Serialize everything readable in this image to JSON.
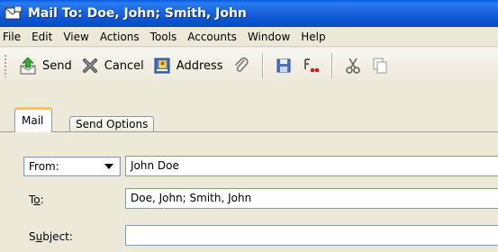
{
  "window": {
    "title": "Mail To: Doe, John; Smith, John"
  },
  "menu": [
    {
      "label": "File",
      "name": "menu-file"
    },
    {
      "label": "Edit",
      "name": "menu-edit"
    },
    {
      "label": "View",
      "name": "menu-view"
    },
    {
      "label": "Actions",
      "name": "menu-actions"
    },
    {
      "label": "Tools",
      "name": "menu-tools"
    },
    {
      "label": "Accounts",
      "name": "menu-accounts"
    },
    {
      "label": "Window",
      "name": "menu-window"
    },
    {
      "label": "Help",
      "name": "menu-help"
    }
  ],
  "toolbar": {
    "send_label": "Send",
    "cancel_label": "Cancel",
    "address_label": "Address",
    "icons": [
      "send-icon",
      "cancel-icon",
      "address-book-icon",
      "paperclip-icon",
      "save-icon",
      "spell-check-icon",
      "cut-icon",
      "copy-icon"
    ]
  },
  "tabs": {
    "mail": "Mail",
    "send_options": "Send Options"
  },
  "form": {
    "from_label": "From:",
    "from_value": "John Doe",
    "to_label_pre": "T",
    "to_label_ul": "o",
    "to_label_post": ":",
    "to_value": "Doe, John; Smith, John",
    "subject_label_pre": "S",
    "subject_label_ul": "u",
    "subject_label_post": "bject:",
    "subject_value": ""
  },
  "colors": {
    "titlebar": "#0a5fe0",
    "active_tab_accent": "#ffc83c",
    "field_border": "#7f9db9",
    "window_bg": "#ece9d8"
  }
}
